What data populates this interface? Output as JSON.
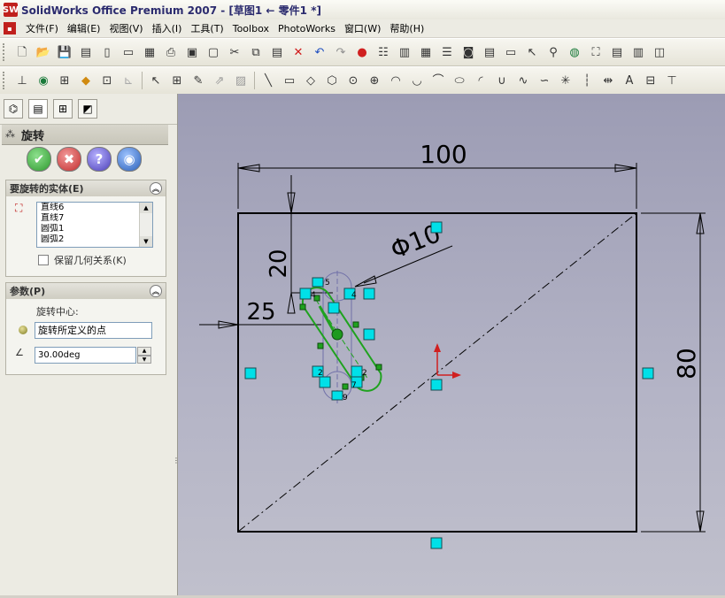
{
  "window": {
    "title": "SolidWorks Office Premium 2007 - [草图1 ← 零件1 *]",
    "logo": "SW"
  },
  "menu": {
    "items": [
      "文件(F)",
      "编辑(E)",
      "视图(V)",
      "插入(I)",
      "工具(T)",
      "Toolbox",
      "PhotoWorks",
      "窗口(W)",
      "帮助(H)"
    ]
  },
  "property_manager": {
    "title": "旋转",
    "group1": {
      "title": "要旋转的实体(E)",
      "items": [
        "直线6",
        "直线7",
        "圆弧1",
        "圆弧2"
      ],
      "keep_relations_label": "保留几何关系(K)"
    },
    "group2": {
      "title": "参数(P)",
      "center_label": "旋转中心:",
      "center_value": "旋转所定义的点",
      "angle_value": "30.00deg"
    }
  },
  "sketch": {
    "dim_width": "100",
    "dim_height": "80",
    "dim_20": "20",
    "dim_25": "25",
    "dim_dia": "Φ10"
  },
  "colors": {
    "sketch_line": "#000000",
    "selected": "#1fa21f",
    "relation_marker": "#00e0e8",
    "viewport_top": "#9c9cb4"
  }
}
